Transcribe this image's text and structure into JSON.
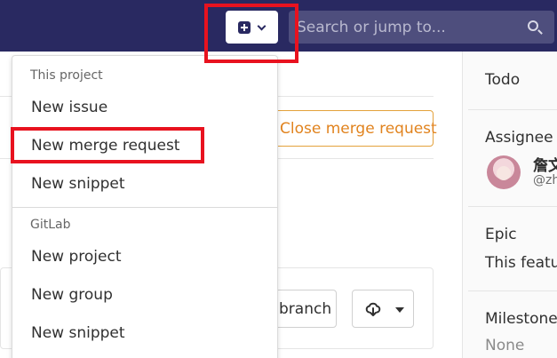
{
  "navbar": {
    "search_placeholder": "Search or jump to..."
  },
  "merge_request": {
    "close_label": "Close merge request",
    "branch_label": "branch"
  },
  "dropdown": {
    "sections": [
      {
        "header": "This project",
        "items": [
          "New issue",
          "New merge request",
          "New snippet"
        ]
      },
      {
        "header": "GitLab",
        "items": [
          "New project",
          "New group",
          "New snippet"
        ]
      }
    ]
  },
  "sidebar": {
    "todo": "Todo",
    "assignee_label": "Assignee",
    "assignee_name": "詹文",
    "assignee_username": "@zh",
    "epic_label": "Epic",
    "epic_value": "This featur",
    "milestone_label": "Milestone",
    "milestone_value": "None"
  },
  "colors": {
    "navbar": "#292961",
    "highlight": "#e8121f",
    "close_button": "#e1831e"
  }
}
